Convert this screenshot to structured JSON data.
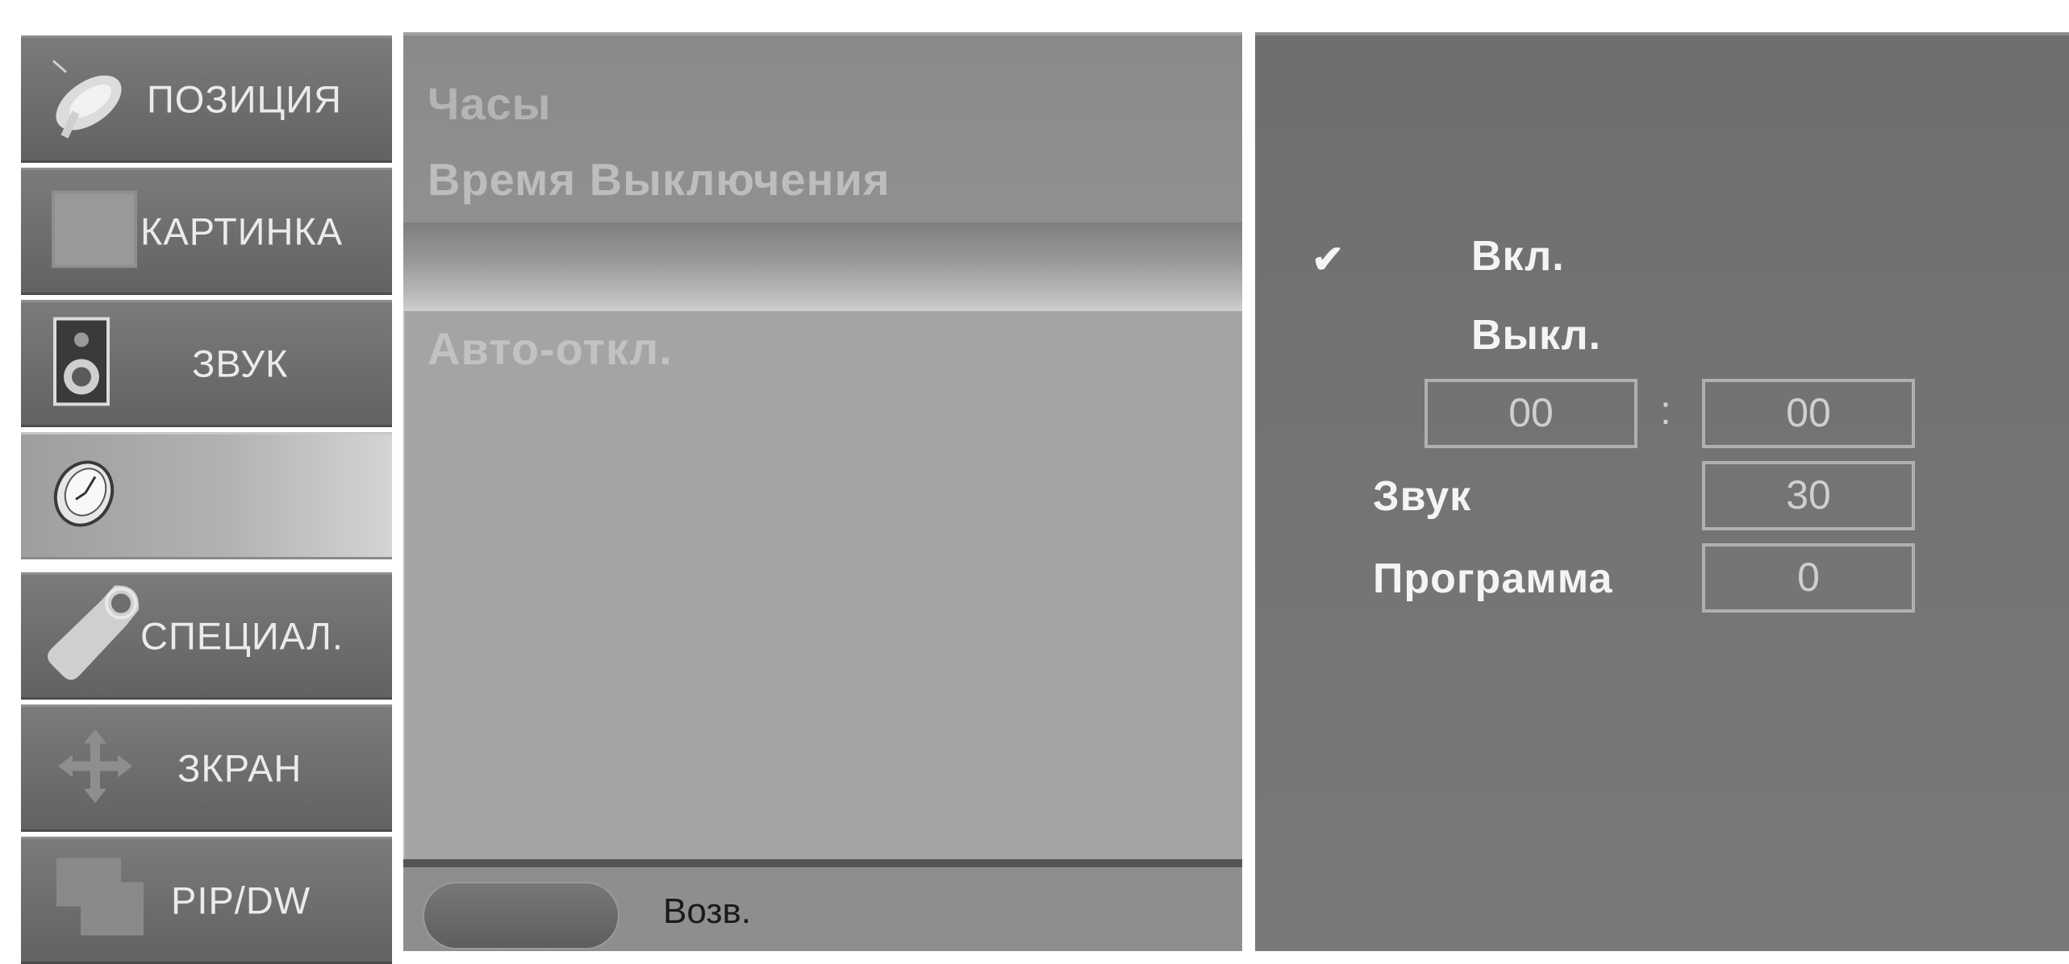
{
  "left_menu": {
    "items": [
      {
        "label": "ПОЗИЦИЯ",
        "icon": "satellite-dish-icon",
        "active": false
      },
      {
        "label": "КАРТИНКА",
        "icon": "picture-square-icon",
        "active": false
      },
      {
        "label": "ЗВУК",
        "icon": "speaker-icon",
        "active": false
      },
      {
        "label": "",
        "icon": "clock-icon",
        "active": true
      },
      {
        "label": "СПЕЦИАЛ.",
        "icon": "tag-icon",
        "active": false
      },
      {
        "label": "ЗКРАН",
        "icon": "move-arrows-icon",
        "active": false
      },
      {
        "label": "PIP/DW",
        "icon": "pip-windows-icon",
        "active": false
      }
    ]
  },
  "middle": {
    "top_items": [
      "Часы",
      "Время Выключения"
    ],
    "selected_item": "Авто-откл.",
    "footer": {
      "back_label": "Возв."
    }
  },
  "right": {
    "options": [
      {
        "label": "Вкл.",
        "checked": true
      },
      {
        "label": "Выкл.",
        "checked": false
      }
    ],
    "check_symbol": "✔",
    "time": {
      "hours": "00",
      "separator": ":",
      "minutes": "00"
    },
    "volume": {
      "label": "Звук",
      "value": "30"
    },
    "program": {
      "label": "Программа",
      "value": "0"
    }
  },
  "colors": {
    "menu_bg": "#6e6e6e",
    "panel_bg": "#a4a4a4",
    "right_bg": "#737373",
    "text_light": "#ebebeb"
  }
}
